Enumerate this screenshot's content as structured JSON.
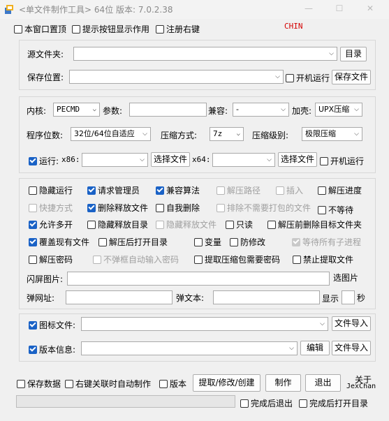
{
  "window": {
    "title": "<单文件制作工具> 64位 版本: 7.0.2.38",
    "chin": "CHIN"
  },
  "top_options": {
    "always_on_top": "本窗口置顶",
    "tooltips": "提示按钮显示作用",
    "register_context": "注册右键"
  },
  "source": {
    "source_folder_label": "源文件夹:",
    "source_folder_value": "",
    "dir_button": "目录",
    "save_location_label": "保存位置:",
    "save_location_value": "",
    "autorun_label": "开机运行",
    "save_file_button": "保存文件"
  },
  "kernel": {
    "kernel_label": "内核:",
    "kernel_value": "PECMD",
    "params_label": "参数:",
    "params_value": "",
    "compat_label": "兼容:",
    "compat_value": "-",
    "shell_label": "加壳:",
    "shell_value": "UPX压缩",
    "bits_label": "程序位数:",
    "bits_value": "32位/64位自适应",
    "compress_method_label": "压缩方式:",
    "compress_method_value": "7z",
    "compress_level_label": "压缩级别:",
    "compress_level_value": "极限压缩",
    "run_label": "运行:",
    "x86_label": "x86:",
    "x86_value": "",
    "select_file_1": "选择文件",
    "x64_label": "x64:",
    "x64_value": "",
    "select_file_2": "选择文件",
    "run_autorun": "开机运行"
  },
  "options": {
    "hide_run": "隐藏运行",
    "request_admin": "请求管理员",
    "compat_algo": "兼容算法",
    "extract_path": "解压路径",
    "insert": "插入",
    "extract_progress": "解压进度",
    "shortcut": "快捷方式",
    "delete_released": "删除释放文件",
    "self_delete": "自我删除",
    "exclude_unneeded": "排除不需要打包的文件",
    "no_wait": "不等待",
    "allow_multi": "允许多开",
    "hide_release_dir": "隐藏释放目录",
    "hide_release_file": "隐藏释放文件",
    "readonly": "只读",
    "delete_target_before": "解压前删除目标文件夹",
    "overwrite_existing": "覆盖现有文件",
    "open_dir_after": "解压后打开目录",
    "variable": "变量",
    "anti_modify": "防修改",
    "wait_children": "等待所有子进程",
    "extract_password": "解压密码",
    "no_popup_password": "不弹框自动输入密码",
    "extract_needs_password": "提取压缩包需要密码",
    "forbid_extract": "禁止提取文件",
    "splash_label": "闪屏图片:",
    "splash_value": "",
    "splash_button": "选图片",
    "popup_url_label": "弹网址:",
    "popup_url_value": "",
    "popup_text_label": "弹文本:",
    "popup_text_value": "",
    "show_label": "显示",
    "seconds_label": "秒",
    "seconds_value": ""
  },
  "resources": {
    "icon_label": "图标文件:",
    "icon_value": "",
    "import_icon_button": "文件导入",
    "version_label": "版本信息:",
    "version_value": "",
    "edit_button": "编辑",
    "import_version_button": "文件导入"
  },
  "bottom": {
    "save_data": "保存数据",
    "auto_make": "右键关联时自动制作",
    "version": "版本",
    "extract_button": "提取/修改/创建",
    "make_button": "制作",
    "exit_button": "退出",
    "about_line1": "关于",
    "about_line2": "JexChan",
    "exit_after": "完成后退出",
    "open_dir_after": "完成后打开目录",
    "progress": 0
  },
  "colors": {
    "accent": "#1a62c6",
    "chin": "#d40000"
  }
}
